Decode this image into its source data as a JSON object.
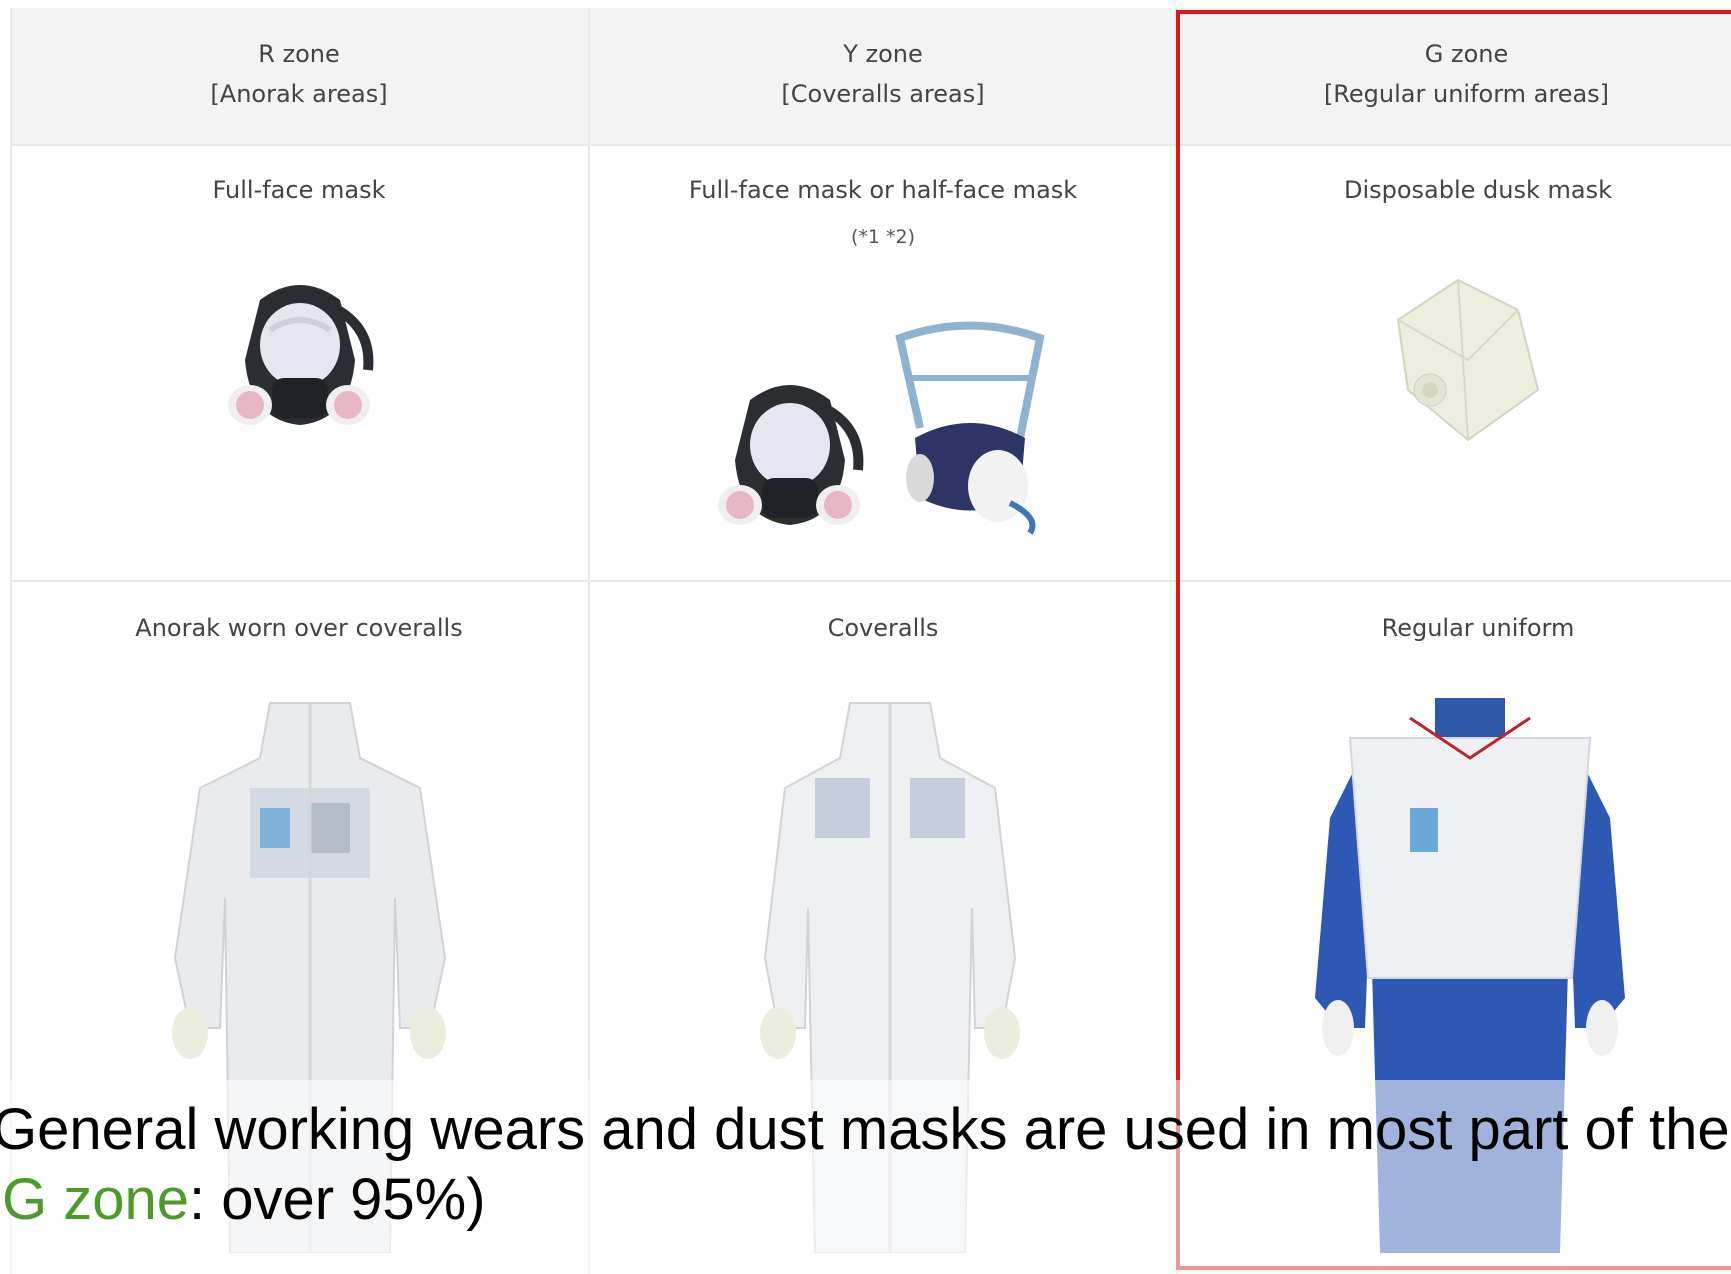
{
  "table": {
    "columns": [
      {
        "zone": "R zone",
        "area": "[Anorak areas]",
        "mask": "Full-face mask",
        "mask_note": "",
        "wear": "Anorak worn over coveralls"
      },
      {
        "zone": "Y zone",
        "area": "[Coveralls areas]",
        "mask": "Full-face mask or half-face mask",
        "mask_note": "(*1 *2)",
        "wear": "Coveralls"
      },
      {
        "zone": "G zone",
        "area": "[Regular uniform areas]",
        "mask": "Disposable dusk mask",
        "mask_note": "",
        "wear": "Regular uniform"
      }
    ],
    "highlight_color": "#e0161c"
  },
  "overlay": {
    "line1": "General working wears and dust masks are used in most part of the s",
    "line2_highlight": "G zone",
    "line2_rest": ": over 95%)",
    "highlight_color": "#4c9a2a"
  }
}
